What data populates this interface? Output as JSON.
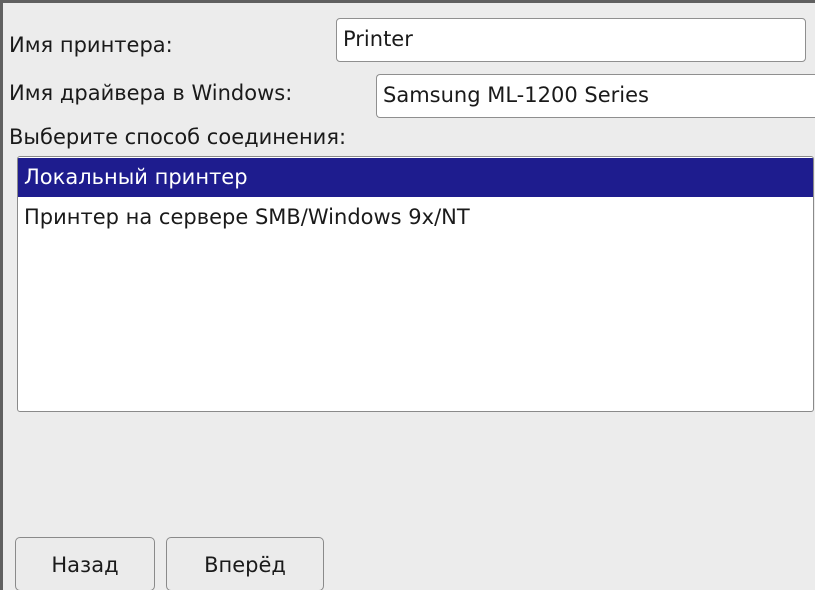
{
  "form": {
    "printer_name_label": "Имя принтера:",
    "printer_name_value": "Printer",
    "driver_name_label": "Имя драйвера в Windows:",
    "driver_name_value": "Samsung ML-1200 Series",
    "connection_label": "Выберите способ соединения:"
  },
  "connection_list": {
    "items": [
      {
        "label": "Локальный принтер",
        "selected": true
      },
      {
        "label": "Принтер на сервере SMB/Windows 9x/NT",
        "selected": false
      }
    ]
  },
  "buttons": {
    "back_label": "Назад",
    "next_label": "Вперёд"
  },
  "colors": {
    "selection": "#1e1c8e",
    "background": "#ececec"
  }
}
